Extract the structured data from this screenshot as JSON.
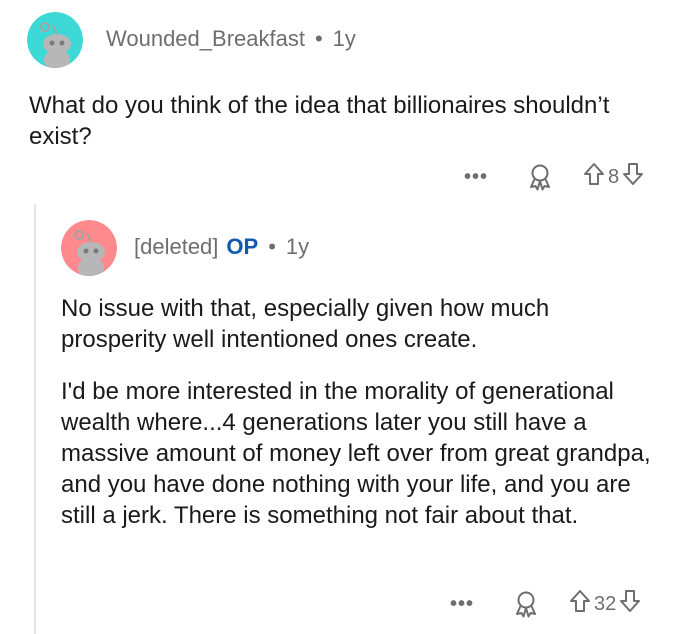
{
  "comments": [
    {
      "username": "Wounded_Breakfast",
      "op_badge": "",
      "age": "1y",
      "avatar_color": "#3dd9d6",
      "paragraphs": [
        "What do you think of the idea that billionaires shouldn’t exist?"
      ],
      "votes": "8"
    },
    {
      "username": "[deleted]",
      "op_badge": "OP",
      "age": "1y",
      "avatar_color": "#ff8a8e",
      "paragraphs": [
        "No issue with that, especially given how much prosperity well intentioned ones create.",
        "I'd be more interested in the morality of generational wealth where...4 generations later you still have a massive amount of money left over from great grandpa, and you have done nothing with your life, and you are still a jerk. There is something not fair about that."
      ],
      "votes": "32"
    }
  ],
  "ui": {
    "more_label": "•••",
    "separator": "•"
  },
  "icons": {
    "more": "more-options-icon",
    "award": "award-icon",
    "upvote": "upvote-arrow-icon",
    "downvote": "downvote-arrow-icon",
    "avatar": "snoo-avatar-icon"
  },
  "colors": {
    "meta_text": "#6e6e6e",
    "op_badge": "#0e5ab5",
    "body_text": "#1a1a1b"
  }
}
